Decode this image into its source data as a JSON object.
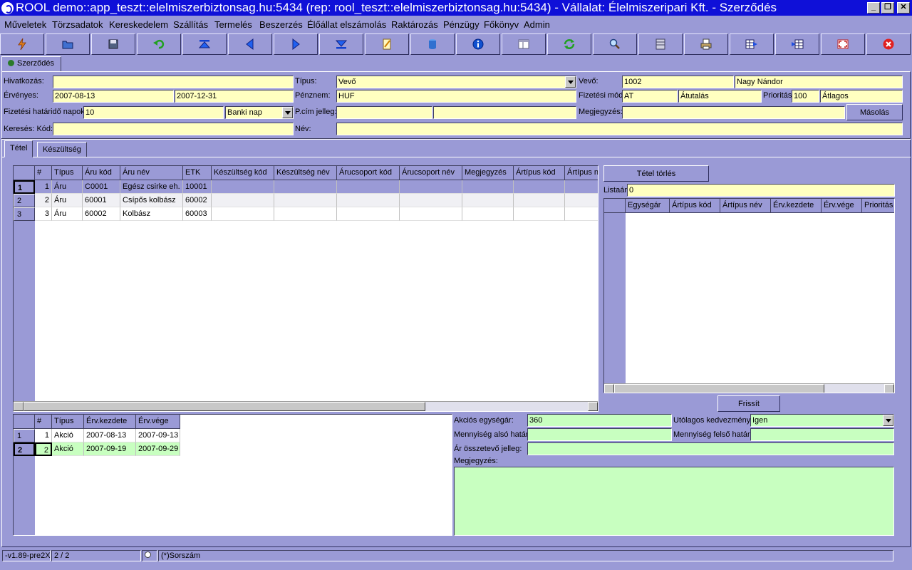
{
  "window": {
    "title": "ROOL demo::app_teszt::elelmiszerbiztonsag.hu:5434 (rep: rool_teszt::elelmiszerbiztonsag.hu:5434) - Vállalat: Élelmiszeripari Kft. - Szerződés"
  },
  "menu": [
    "Műveletek",
    "Törzsadatok",
    "Kereskedelem",
    "Szállítás",
    "Termelés",
    "Beszerzés",
    "Élőállat elszámolás",
    "Raktározás",
    "Pénzügy",
    "Főkönyv",
    "Admin"
  ],
  "toolbar": [
    "execute-icon",
    "open-folder-icon",
    "save-icon",
    "undo-icon",
    "first-icon",
    "prev-icon",
    "next-icon",
    "last-icon",
    "edit-icon",
    "database-icon",
    "info-icon",
    "layout-icon",
    "refresh-icon",
    "search-icon",
    "list-icon",
    "print-icon",
    "grid-export-icon",
    "grid-import-icon",
    "fullscreen-icon",
    "close-icon"
  ],
  "top_tab": "Szerződés",
  "form": {
    "hivatkozas_label": "Hivatkozás:",
    "hivatkozas": "",
    "tipus_label": "Típus:",
    "tipus": "Vevő",
    "vevo_label": "Vevő:",
    "vevo_code": "1002",
    "vevo_name": "Nagy Nándor",
    "ervenyes_label": "Érvényes:",
    "ervenyes_from": "2007-08-13",
    "ervenyes_to": "2007-12-31",
    "penznem_label": "Pénznem:",
    "penznem": "HUF",
    "fizmod_label": "Fizetési mód:",
    "fizmod_code": "AT",
    "fizmod_name": "Átutalás",
    "prioritas_label": "Prioritás:",
    "prioritas_val": "100",
    "prioritas_name": "Átlagos",
    "hatarido_label": "Fizetési határidő napok:",
    "hatarido": "10",
    "hatarido_type": "Banki nap",
    "pcim_label": "P.cím jelleg:",
    "pcim1": "",
    "pcim2": "",
    "megjegyzes_label": "Megjegyzés:",
    "megjegyzes": "",
    "masolas": "Másolás",
    "kereses_label": "Keresés: Kód:",
    "kereses": "",
    "nev_label": "Név:",
    "nev": ""
  },
  "subtabs": [
    "Tétel",
    "Készültség"
  ],
  "items_grid": {
    "headers": [
      "#",
      "Típus",
      "Áru kód",
      "Áru név",
      "ETK",
      "Készültség kód",
      "Készültség név",
      "Árucsoport kód",
      "Árucsoport név",
      "Megjegyzés",
      "Ártípus kód",
      "Ártípus n"
    ],
    "rows": [
      {
        "rn": "1",
        "cells": [
          "1",
          "Áru",
          "C0001",
          "Egész csirke eh.",
          "10001",
          "",
          "",
          "",
          "",
          "",
          "",
          ""
        ]
      },
      {
        "rn": "2",
        "cells": [
          "2",
          "Áru",
          "60001",
          "Csípős kolbász",
          "60002",
          "",
          "",
          "",
          "",
          "",
          "",
          ""
        ]
      },
      {
        "rn": "3",
        "cells": [
          "3",
          "Áru",
          "60002",
          "Kolbász",
          "60003",
          "",
          "",
          "",
          "",
          "",
          "",
          ""
        ]
      }
    ]
  },
  "right": {
    "tetel_torles": "Tétel törlés",
    "listaar_label": "Listaár:",
    "listaar": "0",
    "headers": [
      "Egységár",
      "Ártípus kód",
      "Ártípus név",
      "Érv.kezdete",
      "Érv.vége",
      "Prioritás"
    ],
    "frissit": "Frissít"
  },
  "action_grid": {
    "headers": [
      "#",
      "Típus",
      "Érv.kezdete",
      "Érv.vége"
    ],
    "rows": [
      {
        "rn": "1",
        "cells": [
          "1",
          "Akció",
          "2007-08-13",
          "2007-09-13"
        ]
      },
      {
        "rn": "2",
        "cells": [
          "2",
          "Akció",
          "2007-09-19",
          "2007-09-29"
        ]
      }
    ]
  },
  "action_form": {
    "egysegar_label": "Akciós egységár:",
    "egysegar": "360",
    "utolagos_label": "Utólagos kedvezmény:",
    "utolagos": "Igen",
    "also_label": "Mennyiség alsó határ:",
    "also": "",
    "felso_label": "Mennyiség felső határ:",
    "felso": "",
    "osszetevo_label": "Ár összetevő jelleg:",
    "osszetevo": "",
    "megj_label": "Megjegyzés:",
    "megj": ""
  },
  "status": {
    "version": "-v1.89-pre2X",
    "position": "2 / 2",
    "sorszam": "(*)Sorszám"
  }
}
